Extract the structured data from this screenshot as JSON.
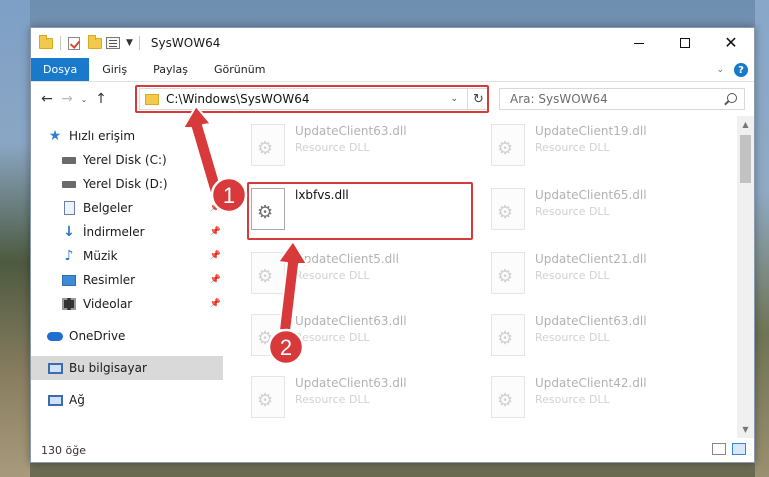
{
  "window": {
    "title": "SysWOW64"
  },
  "ribbon": {
    "tabs": [
      {
        "label": "Dosya"
      },
      {
        "label": "Giriş"
      },
      {
        "label": "Paylaş"
      },
      {
        "label": "Görünüm"
      }
    ]
  },
  "address": {
    "path": "C:\\Windows\\SysWOW64"
  },
  "search": {
    "placeholder": "Ara: SysWOW64"
  },
  "sidebar": {
    "items": [
      {
        "label": "Hızlı erişim"
      },
      {
        "label": "Yerel Disk (C:)"
      },
      {
        "label": "Yerel Disk (D:)"
      },
      {
        "label": "Belgeler"
      },
      {
        "label": "İndirmeler"
      },
      {
        "label": "Müzik"
      },
      {
        "label": "Resimler"
      },
      {
        "label": "Videolar"
      },
      {
        "label": "OneDrive"
      },
      {
        "label": "Bu bilgisayar"
      },
      {
        "label": "Ağ"
      }
    ]
  },
  "files": {
    "left": [
      {
        "name": "UpdateClient63.dll",
        "desc": "Resource DLL"
      },
      {
        "name": "lxbfvs.dll",
        "desc": ""
      },
      {
        "name": "UpdateClient5.dll",
        "desc": "Resource DLL"
      },
      {
        "name": "UpdateClient63.dll",
        "desc": "Resource DLL"
      },
      {
        "name": "UpdateClient63.dll",
        "desc": "Resource DLL"
      }
    ],
    "right": [
      {
        "name": "UpdateClient19.dll",
        "desc": "Resource DLL"
      },
      {
        "name": "UpdateClient65.dll",
        "desc": "Resource DLL"
      },
      {
        "name": "UpdateClient21.dll",
        "desc": "Resource DLL"
      },
      {
        "name": "UpdateClient63.dll",
        "desc": "Resource DLL"
      },
      {
        "name": "UpdateClient42.dll",
        "desc": "Resource DLL"
      }
    ]
  },
  "status": {
    "count": "130 öğe"
  },
  "annotations": {
    "marker1": "1",
    "marker2": "2",
    "color": "#d8393a"
  }
}
